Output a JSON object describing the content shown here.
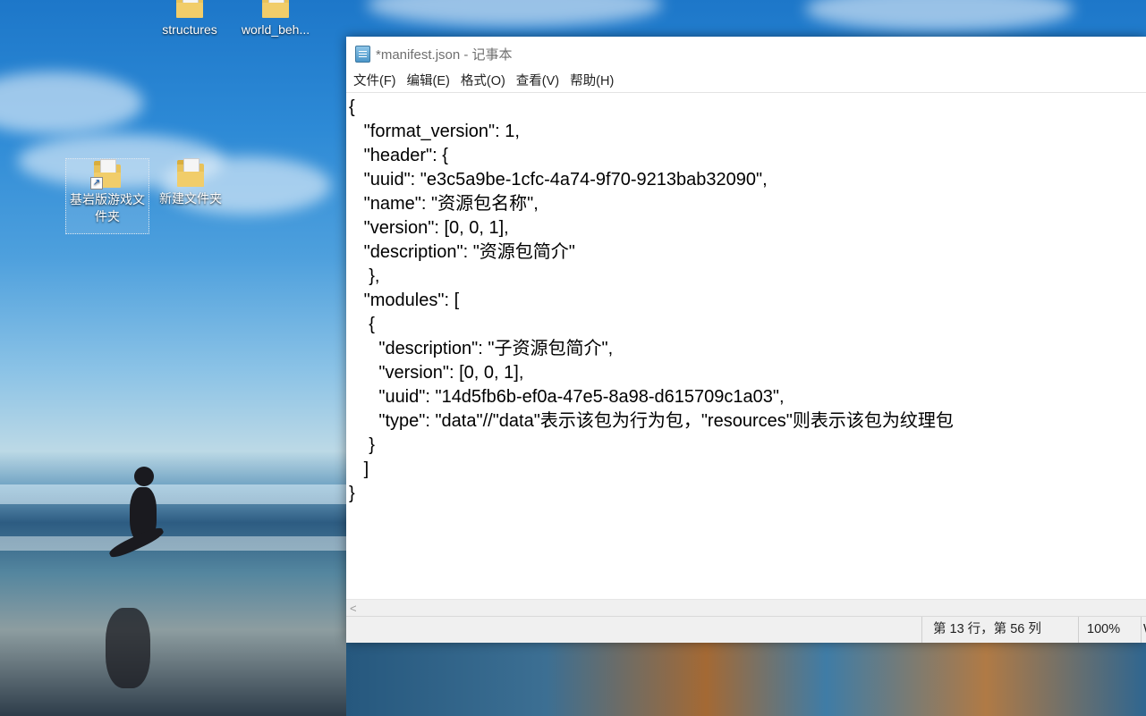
{
  "desktop": {
    "icons": [
      {
        "label": "structures"
      },
      {
        "label": "world_beh..."
      },
      {
        "label": "基岩版游戏文件夹"
      },
      {
        "label": "新建文件夹"
      }
    ]
  },
  "window": {
    "title": "*manifest.json - 记事本",
    "menu": [
      "文件(F)",
      "编辑(E)",
      "格式(O)",
      "查看(V)",
      "帮助(H)"
    ],
    "content": "{\n   \"format_version\": 1,\n   \"header\": {\n   \"uuid\": \"e3c5a9be-1cfc-4a74-9f70-9213bab32090\",\n   \"name\": \"资源包名称\",\n   \"version\": [0, 0, 1],\n   \"description\": \"资源包简介\"\n    },\n   \"modules\": [\n    {\n      \"description\": \"子资源包简介\",\n      \"version\": [0, 0, 1],\n      \"uuid\": \"14d5fb6b-ef0a-47e5-8a98-d615709c1a03\",\n      \"type\": \"data\"//\"data\"表示该包为行为包，\"resources\"则表示该包为纹理包\n    }\n   ]\n}",
    "status": {
      "position": "第 13 行，第 56 列",
      "zoom": "100%",
      "extra": "W"
    }
  }
}
